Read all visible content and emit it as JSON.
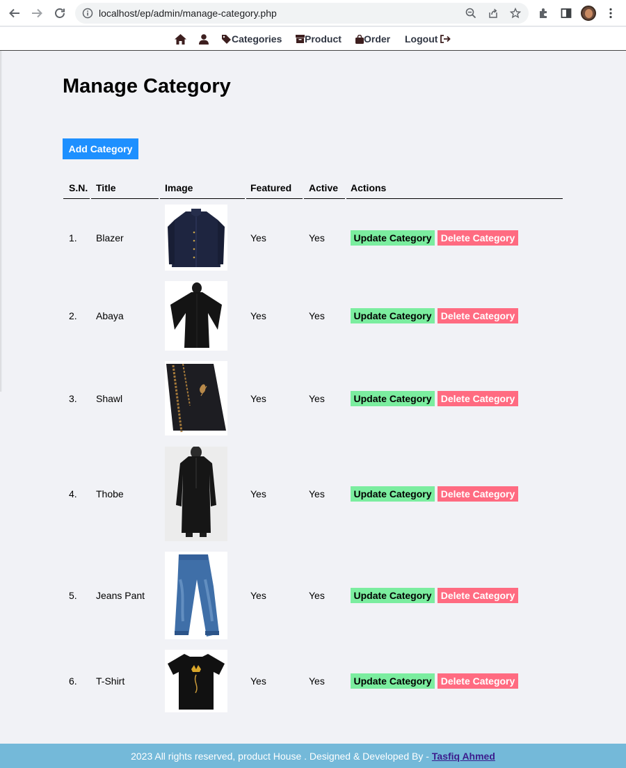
{
  "browser": {
    "url": "localhost/ep/admin/manage-category.php"
  },
  "menu": {
    "categories": "Categories",
    "product": "Product",
    "order": "Order",
    "logout": "Logout"
  },
  "page": {
    "title": "Manage Category",
    "add_button": "Add Category"
  },
  "table": {
    "headers": {
      "sn": "S.N.",
      "title": "Title",
      "image": "Image",
      "featured": "Featured",
      "active": "Active",
      "actions": "Actions"
    },
    "update_label": "Update Category",
    "delete_label": "Delete Category",
    "rows": [
      {
        "sn": "1.",
        "title": "Blazer",
        "image": "blazer",
        "featured": "Yes",
        "active": "Yes"
      },
      {
        "sn": "2.",
        "title": "Abaya",
        "image": "abaya",
        "featured": "Yes",
        "active": "Yes"
      },
      {
        "sn": "3.",
        "title": "Shawl",
        "image": "shawl",
        "featured": "Yes",
        "active": "Yes"
      },
      {
        "sn": "4.",
        "title": "Thobe",
        "image": "thobe",
        "featured": "Yes",
        "active": "Yes"
      },
      {
        "sn": "5.",
        "title": "Jeans Pant",
        "image": "jeans-pant",
        "featured": "Yes",
        "active": "Yes"
      },
      {
        "sn": "6.",
        "title": "T-Shirt",
        "image": "t-shirt",
        "featured": "Yes",
        "active": "Yes"
      }
    ]
  },
  "footer": {
    "text": "2023 All rights reserved, product House . Designed & Developed By -",
    "author": "Tasfiq Ahmed"
  },
  "colors": {
    "add_button": "#1e90ff",
    "update_button": "#7bed9f",
    "delete_button": "#ff6b81",
    "footer": "#74b9d9",
    "background": "#f1f2f6"
  }
}
